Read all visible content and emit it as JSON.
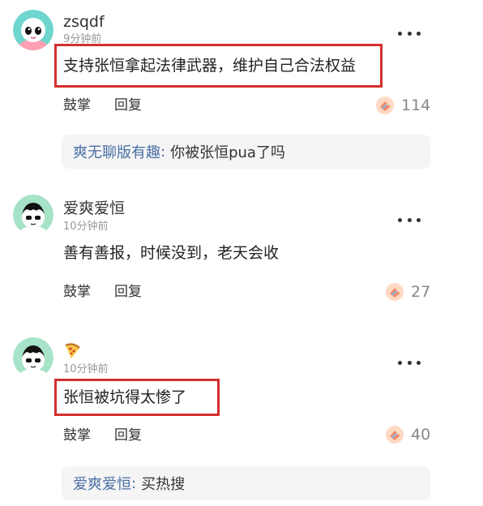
{
  "comments": [
    {
      "username": "zsqdf",
      "time": "9分钟前",
      "content": "支持张恒拿起法律武器，维护自己合法权益",
      "actions": {
        "clap_label": "鼓掌",
        "reply_label": "回复"
      },
      "likes": "114",
      "reply": {
        "author": "爽无聊版有趣",
        "separator": ":",
        "text": "你被张恒pua了吗"
      },
      "avatar_icon": "cartoon-pink-avatar-icon"
    },
    {
      "username": "爱爽爱恒",
      "time": "10分钟前",
      "content": "善有善报，时候没到，老天会收",
      "actions": {
        "clap_label": "鼓掌",
        "reply_label": "回复"
      },
      "likes": "27",
      "avatar_icon": "cartoon-boy-avatar-icon"
    },
    {
      "username_icon": "pizza-emoji-icon",
      "time": "10分钟前",
      "content": "张恒被坑得太惨了",
      "actions": {
        "clap_label": "鼓掌",
        "reply_label": "回复"
      },
      "likes": "40",
      "reply": {
        "author": "爱爽爱恒",
        "separator": ":",
        "text": "买热搜"
      },
      "avatar_icon": "cartoon-boy-avatar-icon"
    }
  ],
  "colors": {
    "highlight_box": "#d32f2f",
    "reply_author": "#4a6fa5",
    "muted_text": "#999999",
    "reply_bg": "#f5f5f5"
  }
}
